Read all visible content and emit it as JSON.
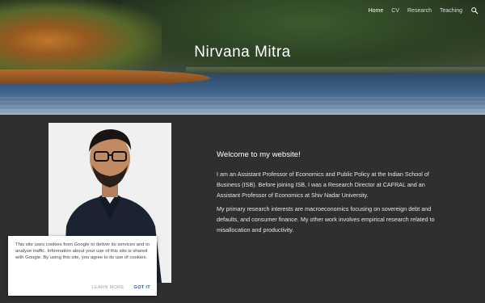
{
  "header": {
    "site_title": "Nirvana Mitra",
    "nav": [
      {
        "label": "Home",
        "active": true
      },
      {
        "label": "CV",
        "active": false
      },
      {
        "label": "Research",
        "active": false
      },
      {
        "label": "Teaching",
        "active": false
      }
    ],
    "search_icon": "search-icon"
  },
  "main": {
    "heading": "Welcome to my website!",
    "paragraphs": [
      "I am an Assistant Professor of Economics and Public Policy at the Indian School of Business (ISB). Before joining ISB, I was a Research Director at CAFRAL and an Assistant Professor of Economics at Shiv Nadar University.",
      "My primary research interests are macroeconomics focusing on sovereign debt and defaults, and consumer finance. My other work involves empirical research related to misallocation and productivity."
    ]
  },
  "cookie_banner": {
    "text": "This site uses cookies from Google to deliver its services and to analyze traffic. Information about your use of this site is shared with Google. By using this site, you agree to its use of cookies.",
    "learn_more": "LEARN MORE",
    "got_it": "GOT IT"
  },
  "colors": {
    "page_background": "#2f2f2f",
    "link_blue": "#2a56c6"
  }
}
